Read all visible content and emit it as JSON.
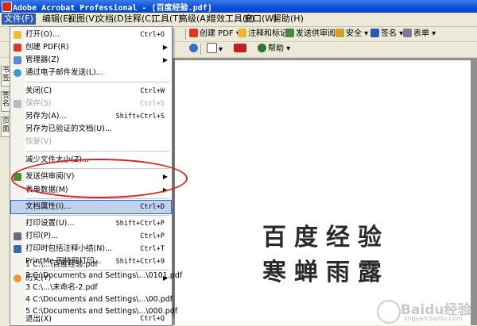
{
  "window": {
    "title": "Adobe Acrobat Professional - [百度经验.pdf]"
  },
  "menubar": [
    {
      "label": "文件(F)"
    },
    {
      "label": "编辑(E)"
    },
    {
      "label": "视图(V)"
    },
    {
      "label": "文档(D)"
    },
    {
      "label": "注释(C)"
    },
    {
      "label": "工具(T)"
    },
    {
      "label": "高级(A)"
    },
    {
      "label": "增效工具(P)"
    },
    {
      "label": "窗口(W)"
    },
    {
      "label": "帮助(H)"
    }
  ],
  "toolbar1": {
    "create_pdf": "创建 PDF",
    "comment_markup": "注释和标记",
    "send_review": "发送供审阅",
    "secure": "安全",
    "sign": "签名",
    "forms": "表单"
  },
  "toolbar2": {
    "help": "帮助"
  },
  "side_tabs": [
    "书签",
    "签名",
    "页面"
  ],
  "file_menu": {
    "items": [
      {
        "label": "打开(O)...",
        "shortcut": "Ctrl+O",
        "icon": "open-folder-icon"
      },
      {
        "label": "创建 PDF(R)",
        "submenu": true,
        "icon": "create-pdf-icon"
      },
      {
        "label": "管理器(Z)",
        "submenu": true,
        "icon": "organizer-icon"
      },
      {
        "label": "通过电子邮件发送(L)...",
        "icon": "email-icon"
      },
      {
        "label": "关闭(C)",
        "shortcut": "Ctrl+W"
      },
      {
        "label": "保存(S)",
        "shortcut": "Ctrl+S",
        "disabled": true,
        "icon": "save-icon"
      },
      {
        "label": "另存为(A)...",
        "shortcut": "Shift+Ctrl+S"
      },
      {
        "label": "另存为已验证的文档(U)..."
      },
      {
        "label": "恢复(V)",
        "disabled": true
      },
      {
        "label": "减少文件大小(Z)..."
      },
      {
        "label": "发送供审阅(V)",
        "submenu": true,
        "icon": "review-icon"
      },
      {
        "label": "表单数据(M)",
        "submenu": true
      },
      {
        "label": "文档属性(I)...",
        "shortcut": "Ctrl+D",
        "highlighted": true
      },
      {
        "label": "打印设置(U)...",
        "shortcut": "Shift+Ctrl+P"
      },
      {
        "label": "打印(P)...",
        "shortcut": "Ctrl+P",
        "icon": "print-icon"
      },
      {
        "label": "打印时包括注释小结(N)...",
        "shortcut": "Ctrl+T",
        "icon": "print-summary-icon"
      },
      {
        "label": "PrintMe 因特网打印...",
        "shortcut": "Shift+Ctrl+9"
      },
      {
        "label": "历史(Y)",
        "submenu": true,
        "icon": "history-icon"
      },
      {
        "label": "1 C:\\...\\百度经验.pdf"
      },
      {
        "label": "2 C:\\Documents and Settings\\...\\0101.pdf"
      },
      {
        "label": "3 C:\\...\\未命名-2.pdf"
      },
      {
        "label": "4 C:\\Documents and Settings\\...\\00.pdf"
      },
      {
        "label": "5 C:\\Documents and Settings\\...\\000.pdf"
      },
      {
        "label": "退出(X)",
        "shortcut": "Ctrl+Q"
      }
    ]
  },
  "document": {
    "line1": "百度经验",
    "line2": "寒蝉雨露"
  },
  "watermark": {
    "brand": "Baidu经验",
    "url": "jingyan.baidu.com"
  },
  "colors": {
    "highlight": "#c1d2ee",
    "annotation": "#e02020",
    "titlebar": "#0a4fd6"
  }
}
